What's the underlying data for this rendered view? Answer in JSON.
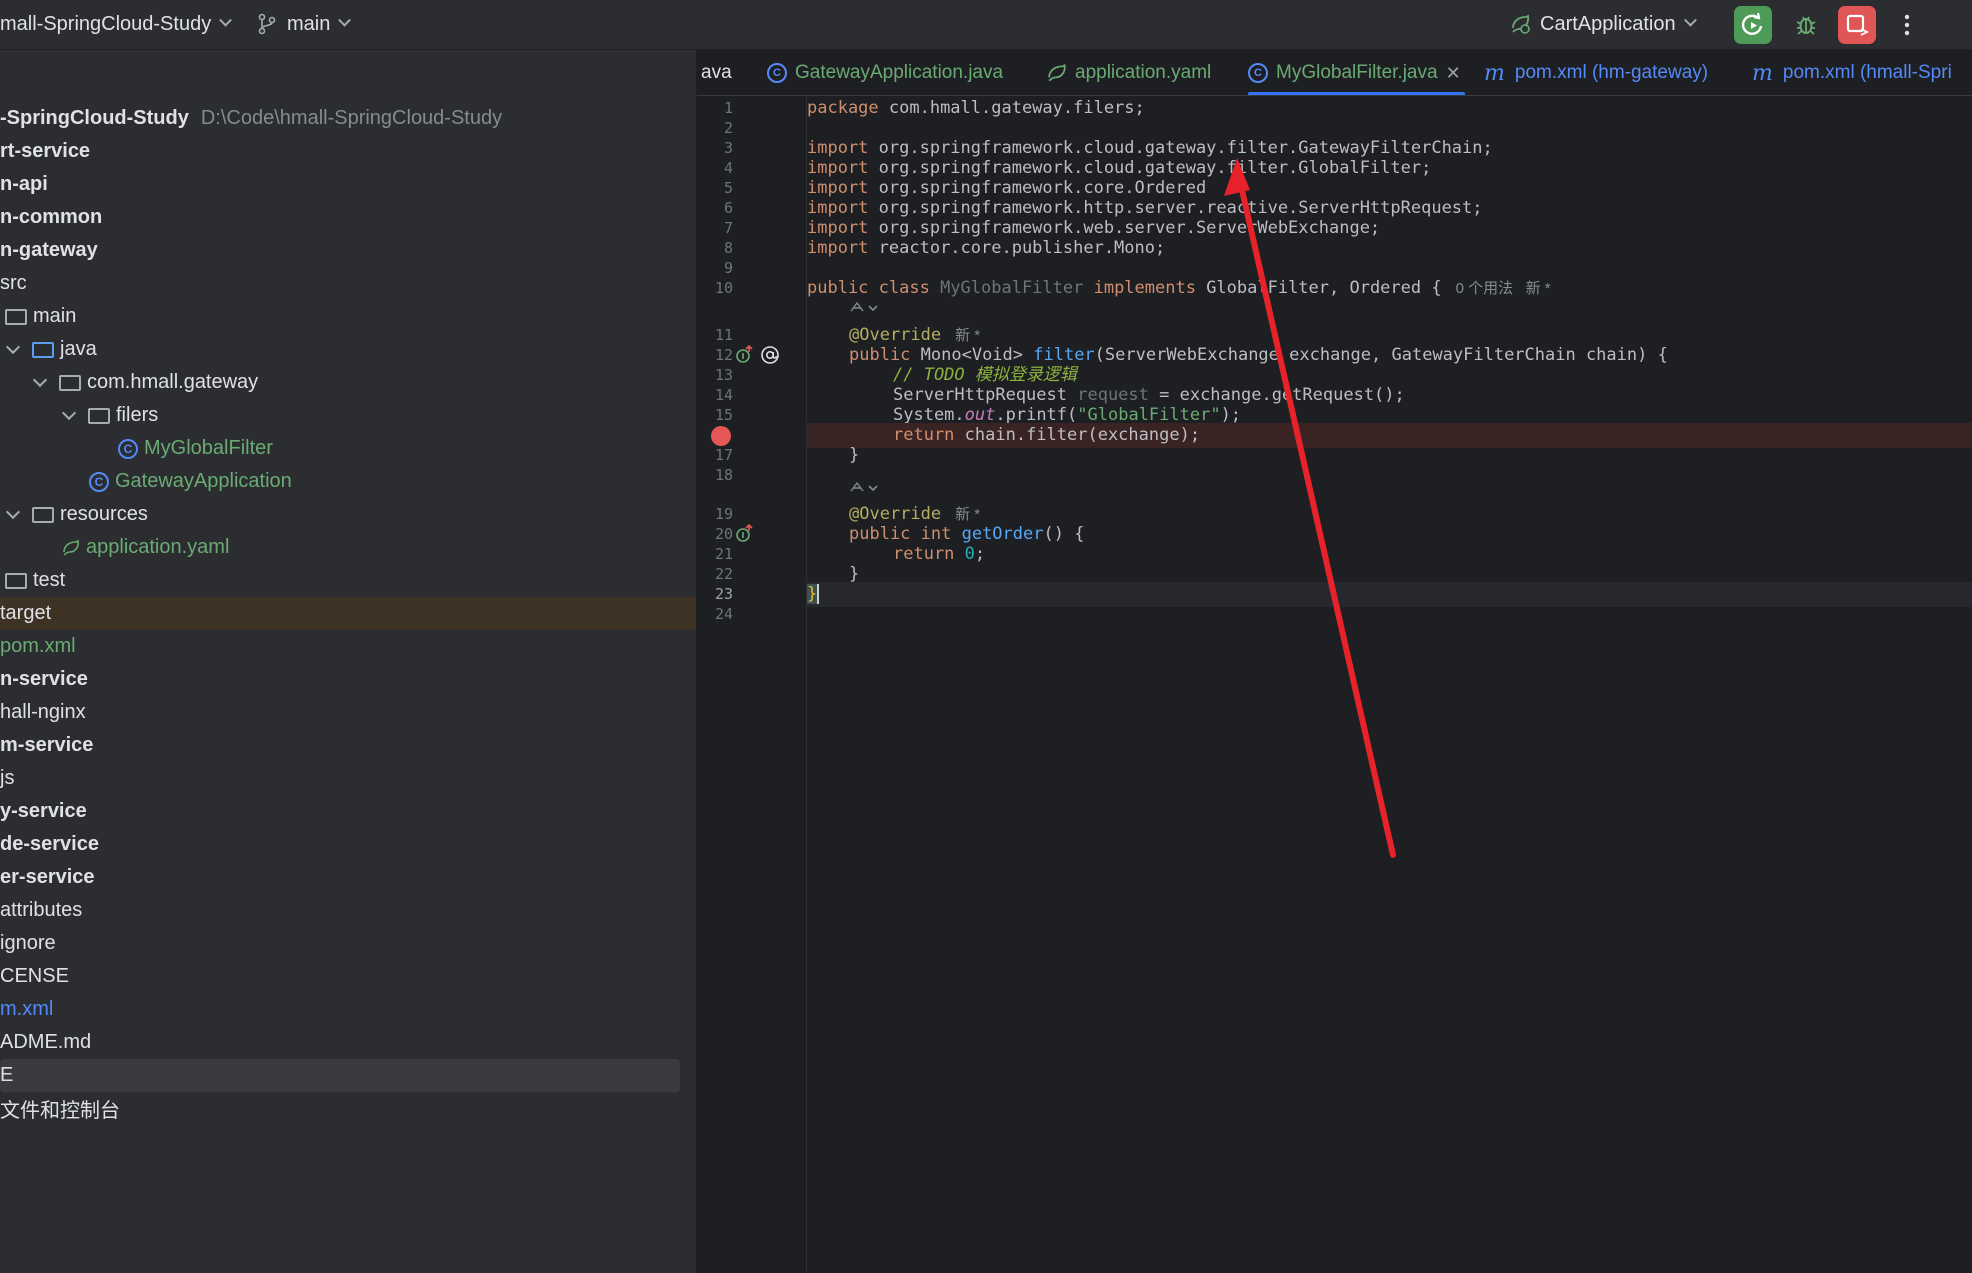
{
  "topbar": {
    "project_name": "mall-SpringCloud-Study",
    "branch": "main",
    "run_config": "CartApplication"
  },
  "sidebar": {
    "rows": [
      {
        "label": "-SpringCloud-Study",
        "path": "D:\\Code\\hmall-SpringCloud-Study"
      },
      {
        "label": "rt-service"
      },
      {
        "label": "n-api"
      },
      {
        "label": "n-common"
      },
      {
        "label": "n-gateway"
      },
      {
        "label": "src"
      },
      {
        "label": "main"
      },
      {
        "label": "java"
      },
      {
        "label": "com.hmall.gateway"
      },
      {
        "label": "filers"
      },
      {
        "label": "MyGlobalFilter"
      },
      {
        "label": "GatewayApplication"
      },
      {
        "label": "resources"
      },
      {
        "label": "application.yaml"
      },
      {
        "label": "test"
      },
      {
        "label": "target"
      },
      {
        "label": "pom.xml"
      },
      {
        "label": "n-service"
      },
      {
        "label": "hall-nginx"
      },
      {
        "label": "m-service"
      },
      {
        "label": "js"
      },
      {
        "label": "y-service"
      },
      {
        "label": "de-service"
      },
      {
        "label": "er-service"
      },
      {
        "label": "attributes"
      },
      {
        "label": "ignore"
      },
      {
        "label": "CENSE"
      },
      {
        "label": "m.xml"
      },
      {
        "label": "ADME.md"
      },
      {
        "label": "E"
      },
      {
        "label": "文件和控制台"
      }
    ]
  },
  "tabs": [
    {
      "label": "ava"
    },
    {
      "label": "GatewayApplication.java"
    },
    {
      "label": "application.yaml"
    },
    {
      "label": "MyGlobalFilter.java"
    },
    {
      "label": "pom.xml (hm-gateway)"
    },
    {
      "label": "pom.xml (hmall-Spri"
    }
  ],
  "editor": {
    "line_numbers": [
      "1",
      "2",
      "3",
      "4",
      "5",
      "6",
      "7",
      "8",
      "9",
      "10",
      "11",
      "12",
      "13",
      "14",
      "15",
      "",
      "17",
      "18",
      "19",
      "20",
      "21",
      "22",
      "23",
      "24"
    ],
    "code": {
      "l1_kw": "package",
      "l1_rest": " com.hmall.gateway.filers;",
      "imp": "import",
      "l3": " org.springframework.cloud.gateway.filter.GatewayFilterChain;",
      "l4": " org.springframework.cloud.gateway.filter.GlobalFilter;",
      "l5": " org.springframework.core.Ordered",
      "l6": " org.springframework.http.server.reactive.ServerHttpRequest;",
      "l7": " org.springframework.web.server.ServerWebExchange;",
      "l8": " reactor.core.publisher.Mono;",
      "l10_public": "public class",
      "l10_name": " MyGlobalFilter ",
      "l10_impl": "implements",
      "l10_rest": " GlobalFilter, Ordered {",
      "l10_hint": "0 个用法   新 *",
      "override": "@Override",
      "new_hint": "新 *",
      "l12_public": "public",
      "l12_type": " Mono<Void> ",
      "l12_fn": "filter",
      "l12_rest": "(ServerWebExchange exchange, GatewayFilterChain chain) {",
      "l13": "// TODO 模拟登录逻辑",
      "l14_a": "ServerHttpRequest ",
      "l14_b": "request",
      "l14_c": " = exchange.getRequest();",
      "l15_a": "System.",
      "l15_out": "out",
      "l15_b": ".printf(",
      "l15_str": "\"GlobalFilter\"",
      "l15_c": ");",
      "l16_kw": "return",
      "l16_rest": " chain.filter(exchange);",
      "brace_close": "}",
      "l20_public": "public int",
      "l20_fn": " getOrder",
      "l20_rest": "() {",
      "l21_kw": "return",
      "l21_num": " 0",
      "l21_end": ";",
      "l23": "}"
    }
  },
  "colors": {
    "annotation_arrow": "#e8222a",
    "accent": "#3574f0",
    "run_green": "#4e9a57",
    "stop_red": "#e05555"
  }
}
